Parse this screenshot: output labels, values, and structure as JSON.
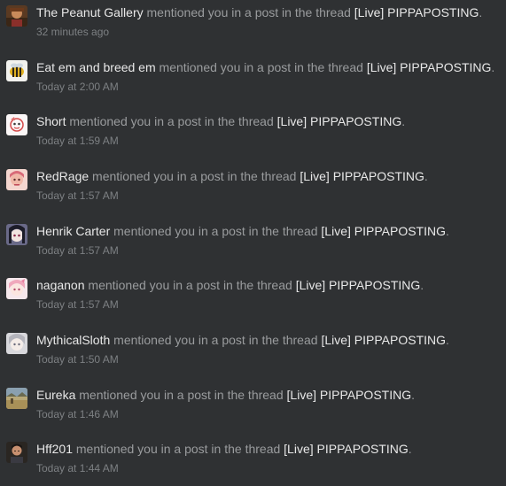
{
  "alerts": [
    {
      "user": "The Peanut Gallery",
      "action": " mentioned you in a post in the thread ",
      "prefix": "[Live]",
      "thread": "PIPPAPOSTING",
      "end": ".",
      "time": "32 minutes ago",
      "avatar_icon": "peanut-gallery-avatar-icon"
    },
    {
      "user": "Eat em and breed em",
      "action": " mentioned you in a post in the thread ",
      "prefix": "[Live]",
      "thread": "PIPPAPOSTING",
      "end": ".",
      "time": "Today at 2:00 AM",
      "avatar_icon": "bee-avatar-icon"
    },
    {
      "user": "Short",
      "action": " mentioned you in a post in the thread ",
      "prefix": "[Live]",
      "thread": "PIPPAPOSTING",
      "end": ".",
      "time": "Today at 1:59 AM",
      "avatar_icon": "anime-girl-avatar-icon"
    },
    {
      "user": "RedRage",
      "action": " mentioned you in a post in the thread ",
      "prefix": "[Live]",
      "thread": "PIPPAPOSTING",
      "end": ".",
      "time": "Today at 1:57 AM",
      "avatar_icon": "pink-character-avatar-icon"
    },
    {
      "user": "Henrik Carter",
      "action": " mentioned you in a post in the thread ",
      "prefix": "[Live]",
      "thread": "PIPPAPOSTING",
      "end": ".",
      "time": "Today at 1:57 AM",
      "avatar_icon": "dark-hair-character-avatar-icon"
    },
    {
      "user": "naganon",
      "action": " mentioned you in a post in the thread ",
      "prefix": "[Live]",
      "thread": "PIPPAPOSTING",
      "end": ".",
      "time": "Today at 1:57 AM",
      "avatar_icon": "pink-hair-character-avatar-icon"
    },
    {
      "user": "MythicalSloth",
      "action": " mentioned you in a post in the thread ",
      "prefix": "[Live]",
      "thread": "PIPPAPOSTING",
      "end": ".",
      "time": "Today at 1:50 AM",
      "avatar_icon": "silver-hair-character-avatar-icon"
    },
    {
      "user": "Eureka",
      "action": " mentioned you in a post in the thread ",
      "prefix": "[Live]",
      "thread": "PIPPAPOSTING",
      "end": ".",
      "time": "Today at 1:46 AM",
      "avatar_icon": "landscape-avatar-icon"
    },
    {
      "user": "Hff201",
      "action": " mentioned you in a post in the thread ",
      "prefix": "[Live]",
      "thread": "PIPPAPOSTING",
      "end": ".",
      "time": "Today at 1:44 AM",
      "avatar_icon": "person-photo-avatar-icon"
    }
  ]
}
